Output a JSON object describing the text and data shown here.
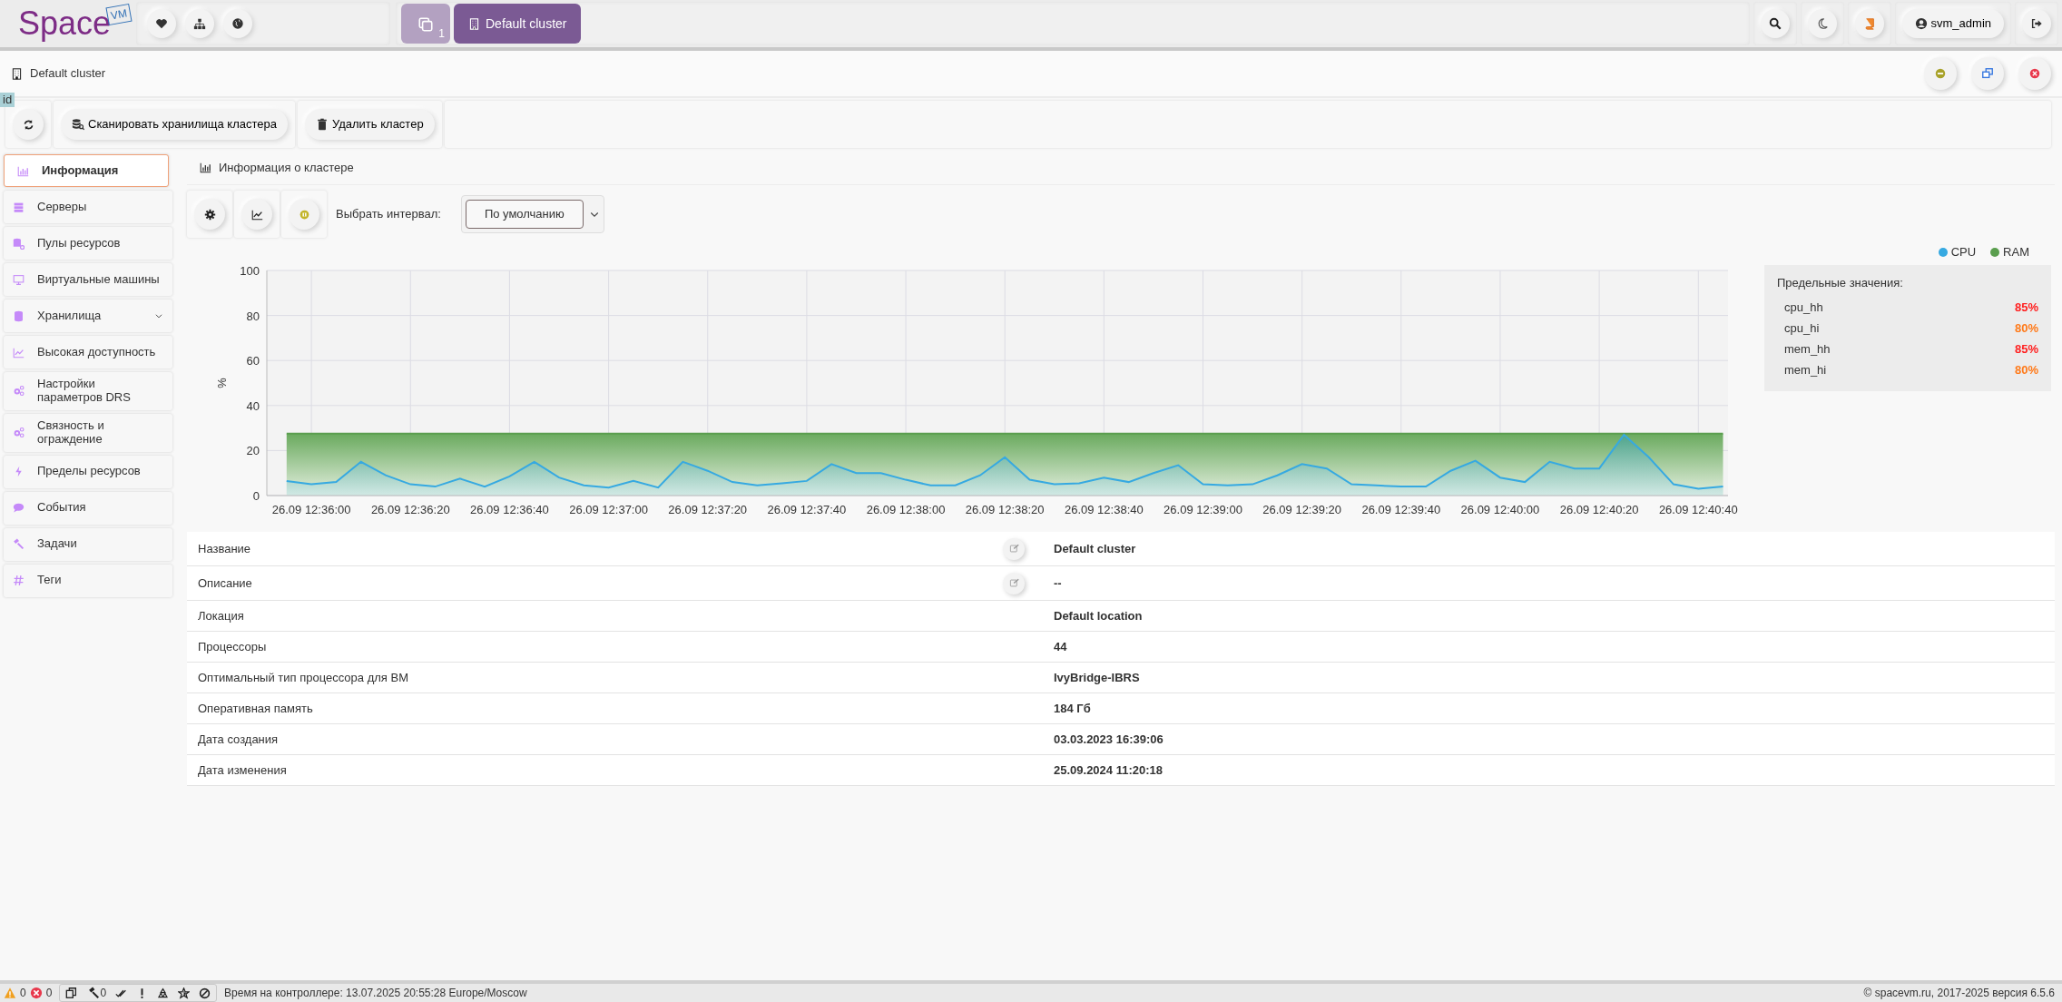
{
  "topbar": {
    "logo_text": "Space",
    "logo_badge": "VM",
    "window_count": "1",
    "tabs": [
      {
        "label": "Default cluster",
        "selected": true
      }
    ],
    "user": "svm_admin"
  },
  "window": {
    "title": "Default cluster"
  },
  "id_tag": "id",
  "toolbar": {
    "buttons": [
      "Сканировать хранилища кластера",
      "Удалить кластер"
    ]
  },
  "sidebar": {
    "items": [
      {
        "label": "Информация",
        "selected": true,
        "kind": "link"
      },
      {
        "label": "Серверы",
        "selected": false,
        "kind": "link"
      },
      {
        "label": "Пулы ресурсов",
        "selected": false,
        "kind": "link"
      },
      {
        "label": "Виртуальные машины",
        "selected": false,
        "kind": "link"
      },
      {
        "label": "Хранилища",
        "selected": false,
        "kind": "group"
      },
      {
        "label": "Высокая доступность",
        "selected": false,
        "kind": "link"
      },
      {
        "label": "Настройки параметров DRS",
        "selected": false,
        "kind": "link"
      },
      {
        "label": "Связность и ограждение",
        "selected": false,
        "kind": "link"
      },
      {
        "label": "Пределы ресурсов",
        "selected": false,
        "kind": "link"
      },
      {
        "label": "События",
        "selected": false,
        "kind": "link"
      },
      {
        "label": "Задачи",
        "selected": false,
        "kind": "link"
      },
      {
        "label": "Теги",
        "selected": false,
        "kind": "link"
      }
    ]
  },
  "section_title": "Информация о кластере",
  "interval": {
    "label": "Выбрать интервал:",
    "value": "По умолчанию"
  },
  "chart": {
    "chart_data": {
      "type": "area",
      "grid": true,
      "ylabel": "%",
      "ylim": [
        0,
        100
      ],
      "yticks": [
        0,
        20,
        40,
        60,
        80,
        100
      ],
      "categories": [
        null,
        "26.09 12:36:00",
        null,
        null,
        null,
        "26.09 12:36:20",
        null,
        null,
        null,
        "26.09 12:36:40",
        null,
        null,
        null,
        "26.09 12:37:00",
        null,
        null,
        null,
        "26.09 12:37:20",
        null,
        null,
        null,
        "26.09 12:37:40",
        null,
        null,
        null,
        "26.09 12:38:00",
        null,
        null,
        null,
        "26.09 12:38:20",
        null,
        null,
        null,
        "26.09 12:38:40",
        null,
        null,
        null,
        "26.09 12:39:00",
        null,
        null,
        null,
        "26.09 12:39:20",
        null,
        null,
        null,
        "26.09 12:39:40",
        null,
        null,
        null,
        "26.09 12:40:00",
        null,
        null,
        null,
        "26.09 12:40:20",
        null,
        null,
        null,
        "26.09 12:40:40",
        null
      ],
      "series": [
        {
          "name": "CPU",
          "color": "#36a9e1",
          "values": [
            6.5,
            5,
            6,
            15,
            9,
            5,
            4,
            7.5,
            4,
            8.5,
            15,
            8,
            4.5,
            3.5,
            6.5,
            3.6,
            15,
            11,
            6,
            4.5,
            5.5,
            6.5,
            14,
            10,
            10,
            7,
            4.5,
            4.5,
            9,
            17,
            7,
            5,
            5.5,
            8,
            6,
            10,
            13.5,
            5,
            4.5,
            5,
            9,
            14,
            12,
            5,
            4.5,
            4,
            4,
            11,
            15.5,
            8,
            6,
            15,
            12,
            12,
            27,
            17,
            5,
            3,
            4
          ]
        },
        {
          "name": "RAM",
          "color": "#5a9e4e",
          "values": [
            27.5,
            27.5,
            27.5,
            27.5,
            27.5,
            27.5,
            27.5,
            27.5,
            27.5,
            27.5,
            27.5,
            27.5,
            27.5,
            27.5,
            27.5,
            27.5,
            27.5,
            27.5,
            27.5,
            27.5,
            27.5,
            27.5,
            27.5,
            27.5,
            27.5,
            27.5,
            27.5,
            27.5,
            27.5,
            27.5,
            27.5,
            27.5,
            27.5,
            27.5,
            27.5,
            27.5,
            27.5,
            27.5,
            27.5,
            27.5,
            27.5,
            27.5,
            27.5,
            27.5,
            27.5,
            27.5,
            27.5,
            27.5,
            27.5,
            27.5,
            27.5,
            27.5,
            27.5,
            27.5,
            27.5,
            27.5,
            27.5,
            27.5,
            27.5
          ]
        }
      ]
    }
  },
  "thresholds": {
    "title": "Предельные значения:",
    "items": [
      {
        "name": "cpu_hh",
        "value": "85%",
        "color": "#ff2020"
      },
      {
        "name": "cpu_hi",
        "value": "80%",
        "color": "#ff7a1a"
      },
      {
        "name": "mem_hh",
        "value": "85%",
        "color": "#ff2020"
      },
      {
        "name": "mem_hi",
        "value": "80%",
        "color": "#ff7a1a"
      }
    ]
  },
  "details": {
    "rows": [
      {
        "label": "Название",
        "value": "Default cluster",
        "editable": true
      },
      {
        "label": "Описание",
        "value": "--",
        "editable": true
      },
      {
        "label": "Локация",
        "value": "Default location",
        "editable": false
      },
      {
        "label": "Процессоры",
        "value": "44",
        "editable": false
      },
      {
        "label": "Оптимальный тип процессора для ВМ",
        "value": "IvyBridge-IBRS",
        "editable": false
      },
      {
        "label": "Оперативная память",
        "value": "184 Гб",
        "editable": false
      },
      {
        "label": "Дата создания",
        "value": "03.03.2023 16:39:06",
        "editable": false
      },
      {
        "label": "Дата изменения",
        "value": "25.09.2024 11:20:18",
        "editable": false
      }
    ]
  },
  "status_bar": {
    "warnings": "0",
    "errors": "0",
    "tasks": "0",
    "time": "Время на контроллере: 13.07.2025 20:55:28 Europe/Moscow",
    "copyright": "© spacevm.ru, 2017-2025 версия 6.5.6"
  }
}
